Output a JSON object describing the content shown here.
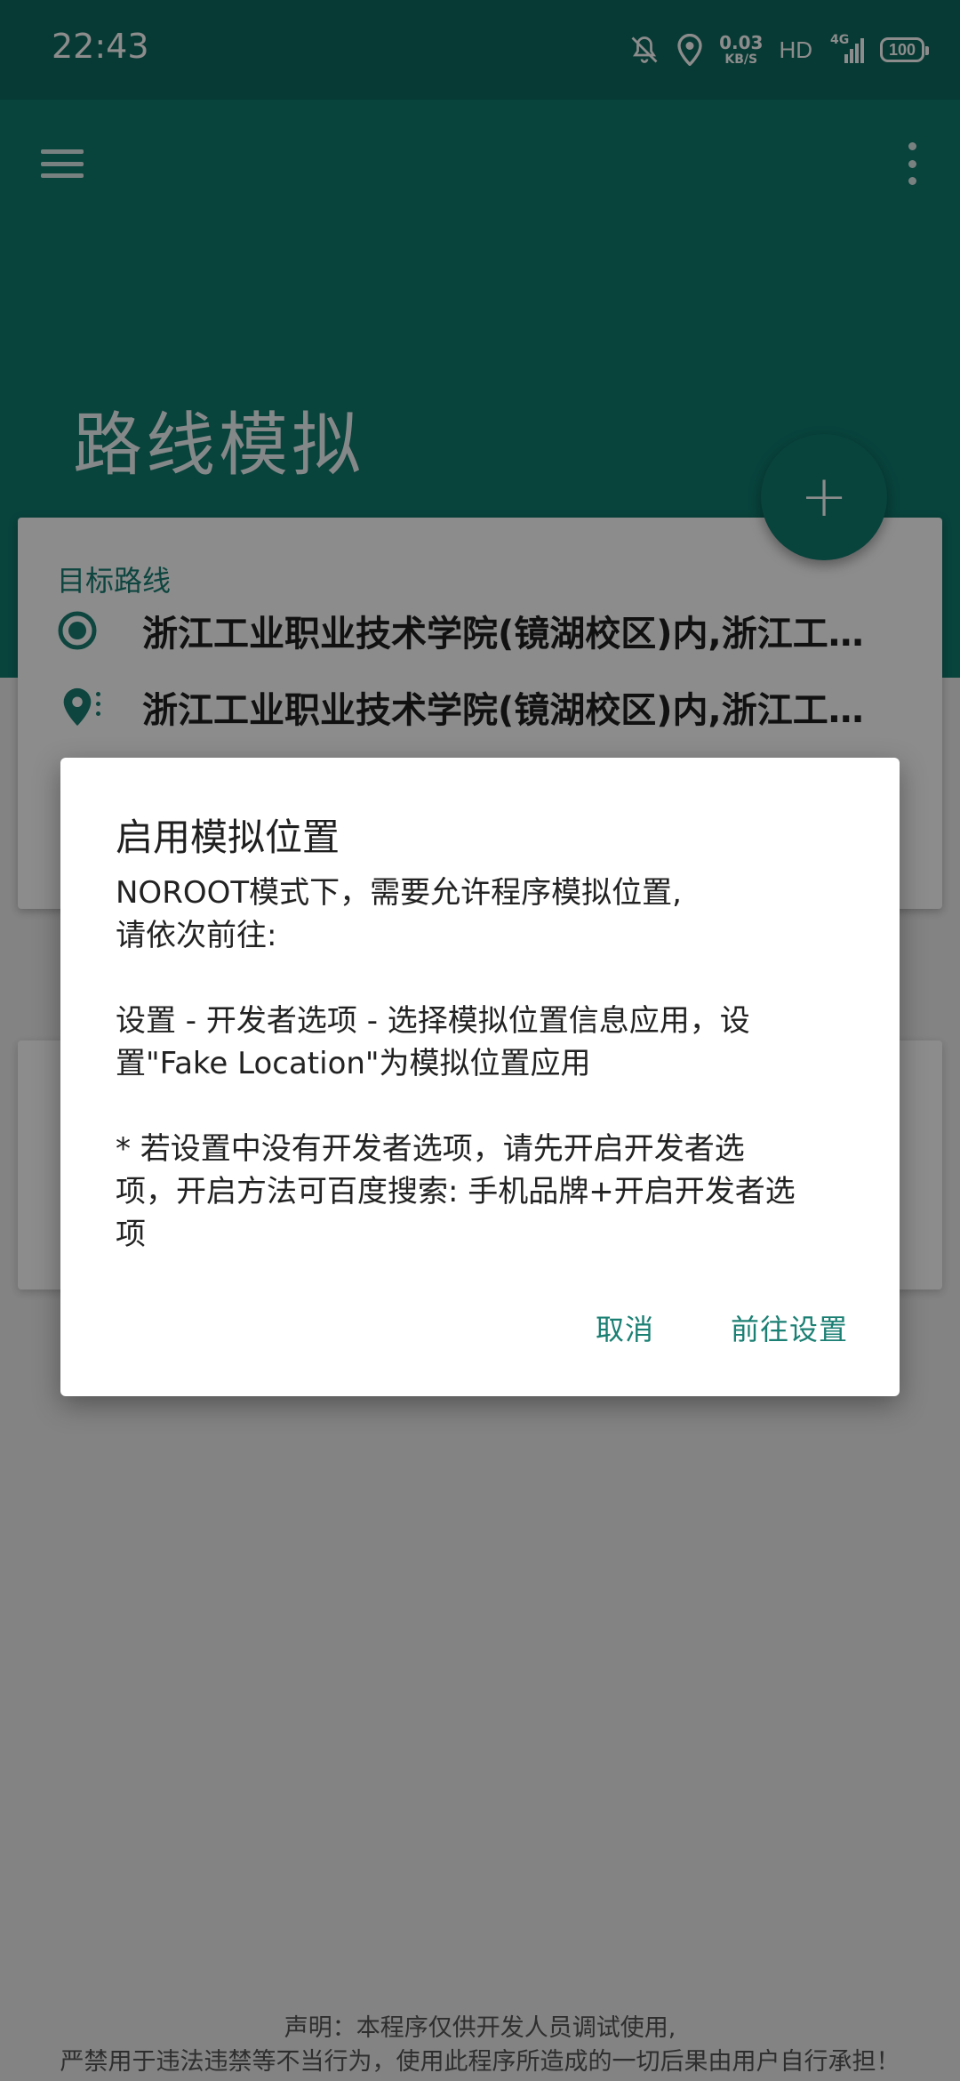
{
  "status_bar": {
    "time": "22:43",
    "net_speed_value": "0.03",
    "net_speed_unit": "KB/S",
    "hd": "HD",
    "network": "4G",
    "battery": "100"
  },
  "app_bar": {
    "menu_icon": "hamburger-menu-icon",
    "overflow_icon": "more-vert-icon",
    "title": "路线模拟"
  },
  "route_card": {
    "label": "目标路线",
    "start": "浙江工业职业技术学院(镜湖校区)内,浙江工业职业技术学院",
    "end": "浙江工业职业技术学院(镜湖校区)内,浙江工业职业技术学院"
  },
  "fab": {
    "icon": "plus-icon",
    "glyph": "+"
  },
  "dialog": {
    "title": "启用模拟位置",
    "para1_line1": "NOROOT模式下，需要允许程序模拟位置,",
    "para1_line2": "请依次前往:",
    "para2_line1": "设置 - 开发者选项 - 选择模拟位置信息应用，设",
    "para2_line2": "置\"Fake Location\"为模拟位置应用",
    "para3_line1": "* 若设置中没有开发者选项，请先开启开发者选",
    "para3_line2": "项，开启方法可百度搜索: 手机品牌+开启开发者选",
    "para3_line3": "项",
    "cancel_label": "取消",
    "confirm_label": "前往设置"
  },
  "disclaimer": {
    "line1": "声明：本程序仅供开发人员调试使用,",
    "line2": "严禁用于违法违禁等不当行为，使用此程序所造成的一切后果由用户自行承担！"
  },
  "colors": {
    "primary": "#0f7a6e",
    "accent": "#1b7f73"
  }
}
